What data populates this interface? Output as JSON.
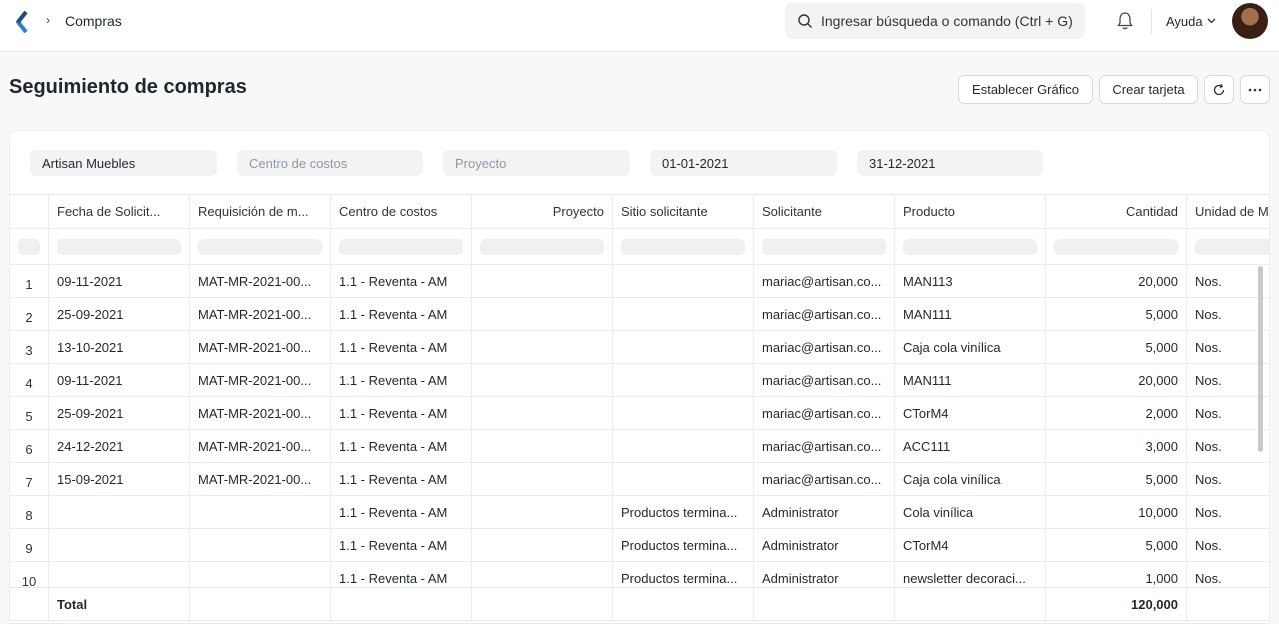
{
  "navbar": {
    "breadcrumb": "Compras",
    "search_placeholder": "Ingresar búsqueda o comando (Ctrl + G)",
    "help": "Ayuda"
  },
  "page": {
    "title": "Seguimiento de compras",
    "buttons": {
      "set_chart": "Establecer Gráfico",
      "create_card": "Crear tarjeta"
    }
  },
  "filters": {
    "company": "Artisan Muebles",
    "cost_center_placeholder": "Centro de costos",
    "project_placeholder": "Proyecto",
    "from_date": "01-01-2021",
    "to_date": "31-12-2021"
  },
  "table": {
    "columns": [
      "Fecha de Solicit...",
      "Requisición de m...",
      "Centro de costos",
      "Proyecto",
      "Sitio solicitante",
      "Solicitante",
      "Producto",
      "Cantidad",
      "Unidad de M"
    ],
    "rows": [
      {
        "n": "1",
        "date": "09-11-2021",
        "req": "MAT-MR-2021-00...",
        "cc": "1.1 - Reventa - AM",
        "project": "",
        "site": "",
        "requester": "mariac@artisan.co...",
        "product": "MAN113",
        "qty": "20,000",
        "uom": "Nos."
      },
      {
        "n": "2",
        "date": "25-09-2021",
        "req": "MAT-MR-2021-00...",
        "cc": "1.1 - Reventa - AM",
        "project": "",
        "site": "",
        "requester": "mariac@artisan.co...",
        "product": "MAN111",
        "qty": "5,000",
        "uom": "Nos."
      },
      {
        "n": "3",
        "date": "13-10-2021",
        "req": "MAT-MR-2021-00...",
        "cc": "1.1 - Reventa - AM",
        "project": "",
        "site": "",
        "requester": "mariac@artisan.co...",
        "product": "Caja cola vinílica",
        "qty": "5,000",
        "uom": "Nos."
      },
      {
        "n": "4",
        "date": "09-11-2021",
        "req": "MAT-MR-2021-00...",
        "cc": "1.1 - Reventa - AM",
        "project": "",
        "site": "",
        "requester": "mariac@artisan.co...",
        "product": "MAN111",
        "qty": "20,000",
        "uom": "Nos."
      },
      {
        "n": "5",
        "date": "25-09-2021",
        "req": "MAT-MR-2021-00...",
        "cc": "1.1 - Reventa - AM",
        "project": "",
        "site": "",
        "requester": "mariac@artisan.co...",
        "product": "CTorM4",
        "qty": "2,000",
        "uom": "Nos."
      },
      {
        "n": "6",
        "date": "24-12-2021",
        "req": "MAT-MR-2021-00...",
        "cc": "1.1 - Reventa - AM",
        "project": "",
        "site": "",
        "requester": "mariac@artisan.co...",
        "product": "ACC111",
        "qty": "3,000",
        "uom": "Nos."
      },
      {
        "n": "7",
        "date": "15-09-2021",
        "req": "MAT-MR-2021-00...",
        "cc": "1.1 - Reventa - AM",
        "project": "",
        "site": "",
        "requester": "mariac@artisan.co...",
        "product": "Caja cola vinílica",
        "qty": "5,000",
        "uom": "Nos."
      },
      {
        "n": "8",
        "date": "",
        "req": "",
        "cc": "1.1 - Reventa - AM",
        "project": "",
        "site": "Productos termina...",
        "requester": "Administrator",
        "product": "Cola vinílica",
        "qty": "10,000",
        "uom": "Nos."
      },
      {
        "n": "9",
        "date": "",
        "req": "",
        "cc": "1.1 - Reventa - AM",
        "project": "",
        "site": "Productos termina...",
        "requester": "Administrator",
        "product": "CTorM4",
        "qty": "5,000",
        "uom": "Nos."
      },
      {
        "n": "10",
        "date": "",
        "req": "",
        "cc": "1.1 - Reventa - AM",
        "project": "",
        "site": "Productos termina...",
        "requester": "Administrator",
        "product": "newsletter decoraci...",
        "qty": "1,000",
        "uom": "Nos."
      }
    ],
    "total_label": "Total",
    "total_qty": "120,000"
  }
}
